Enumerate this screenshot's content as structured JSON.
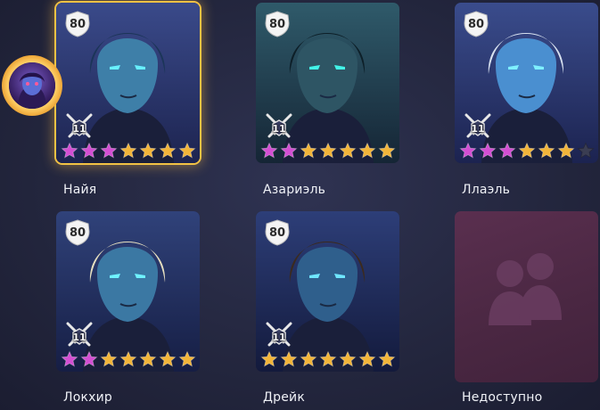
{
  "heroes": [
    {
      "id": "naya",
      "name": "Найя",
      "level": "80",
      "rank": "11",
      "stars": [
        "purple",
        "purple",
        "purple",
        "gold",
        "gold",
        "gold",
        "gold"
      ],
      "selected": true
    },
    {
      "id": "azariel",
      "name": "Азариэль",
      "level": "80",
      "rank": "11",
      "stars": [
        "purple",
        "purple",
        "gold",
        "gold",
        "gold",
        "gold",
        "gold"
      ]
    },
    {
      "id": "llael",
      "name": "Ллаэль",
      "level": "80",
      "rank": "11",
      "stars": [
        "purple",
        "purple",
        "purple",
        "gold",
        "gold",
        "gold",
        "empty"
      ]
    },
    {
      "id": "lokhir",
      "name": "Локхир",
      "level": "80",
      "rank": "11",
      "stars": [
        "purple",
        "purple",
        "gold",
        "gold",
        "gold",
        "gold",
        "gold"
      ]
    },
    {
      "id": "dreik",
      "name": "Дрейк",
      "level": "80",
      "rank": "11",
      "stars": [
        "gold",
        "gold",
        "gold",
        "gold",
        "gold",
        "gold",
        "gold"
      ]
    }
  ],
  "locked_slot": {
    "label": "Недоступно",
    "icon": "heroes-silhouette-icon"
  },
  "selected_avatar": {
    "icon": "hero-avatar-icon"
  },
  "colors": {
    "star_gold": "#f2b53a",
    "star_purple": "#d34fd3",
    "star_empty": "#3a3d52",
    "selected_border": "#f2c244",
    "locked_bg": "#55304d"
  }
}
